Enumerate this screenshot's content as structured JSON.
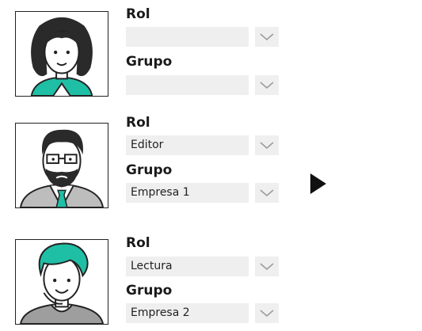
{
  "users": [
    {
      "avatar_icon": "woman-avatar-icon",
      "rol_label": "Rol",
      "rol_value": "",
      "grupo_label": "Grupo",
      "grupo_value": ""
    },
    {
      "avatar_icon": "bearded-man-glasses-avatar-icon",
      "rol_label": "Rol",
      "rol_value": "Editor",
      "grupo_label": "Grupo",
      "grupo_value": "Empresa 1"
    },
    {
      "avatar_icon": "man-teal-hair-avatar-icon",
      "rol_label": "Rol",
      "rol_value": "Lectura",
      "grupo_label": "Grupo",
      "grupo_value": "Empresa 2"
    }
  ],
  "colors": {
    "accent": "#1fbfa6",
    "field_bg": "#efefef"
  },
  "cursor_icon": "pointer-arrow-icon"
}
